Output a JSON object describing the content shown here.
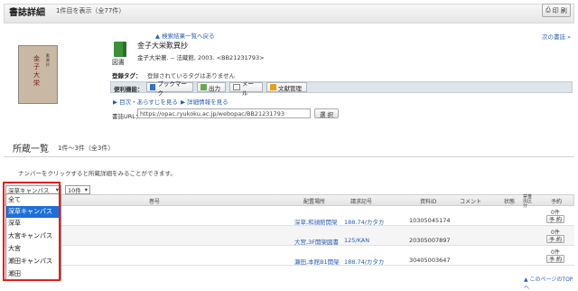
{
  "header": {
    "title": "書誌詳細",
    "count": "1件目を表示（全77件）",
    "print_label": "印 刷"
  },
  "nav": {
    "back_to_list": "▲ 検索結果一覧へ戻る",
    "next_book": "次の書誌 »"
  },
  "cover": {
    "title_text": "金子大栄",
    "subtitle_text": "歎異抄"
  },
  "book": {
    "type_label": "図書",
    "title": "金子大栄歎異抄",
    "meta": "金子大栄著. -- 法蔵館, 2003. <BB21231793>"
  },
  "tags": {
    "label": "登録タグ：",
    "value": "登録されているタグはありません"
  },
  "tools": {
    "label": "便利機能：",
    "buttons": [
      {
        "label": "ブックマーク",
        "color": "#3a6fc4"
      },
      {
        "label": "出力",
        "color": "#6aa84f"
      },
      {
        "label": "メール",
        "color": "#999999"
      },
      {
        "label": "文献管理",
        "color": "#e6a118"
      }
    ]
  },
  "links": {
    "outline": "▶ 目次・あらすじを見る",
    "detail": "▶ 詳細情報を見る"
  },
  "url": {
    "label": "書誌URL：",
    "value": "https://opac.ryukoku.ac.jp/webopac/BB21231793",
    "select_label": "選 択"
  },
  "holdings": {
    "title": "所蔵一覧",
    "count": "1件～3件（全3件）",
    "hint": "ナンバーをクリックすると所蔵詳細をみることができます。"
  },
  "filters": {
    "location_selected": "深草キャンパス",
    "per_page": "10件",
    "location_options": [
      "全て",
      "深草キャンパス",
      "深草",
      "大宮キャンパス",
      "大宮",
      "瀬田キャンパス",
      "瀬田"
    ],
    "selected_index": 1
  },
  "table": {
    "headers": [
      "巻号",
      "配置場所",
      "請求記号",
      "資料ID",
      "コメント",
      "状態",
      "禁帯出区分",
      "予約"
    ],
    "rows": [
      {
        "location": "深草,和顔館開架",
        "call_no": "188.74/カタカ",
        "item_id": "10305045174",
        "count": "0件",
        "reserve": "予 約"
      },
      {
        "location": "大宮,3F開架図書",
        "call_no": "125/KAN",
        "item_id": "20305007897",
        "count": "0件",
        "reserve": "予 約"
      },
      {
        "location": "瀬田,本館B1開架",
        "call_no": "188.74/カタカ",
        "item_id": "30405003647",
        "count": "0件",
        "reserve": "予 約"
      }
    ]
  },
  "footer": {
    "top_link": "▲ このページのTOPへ"
  }
}
